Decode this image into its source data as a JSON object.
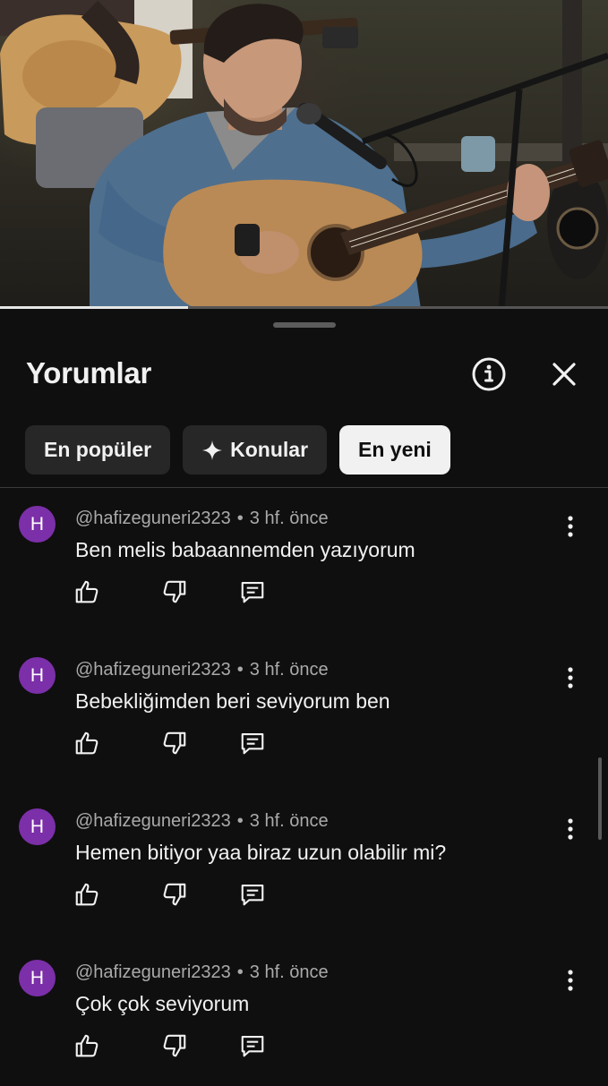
{
  "video": {
    "progress_fraction": 0.31
  },
  "panel": {
    "title": "Yorumlar",
    "info_icon": "info-circle-icon",
    "close_icon": "close-icon"
  },
  "chips": [
    {
      "label": "En popüler",
      "selected": false
    },
    {
      "label": "Konular",
      "icon": "sparkle-icon",
      "selected": false
    },
    {
      "label": "En yeni",
      "selected": true
    }
  ],
  "comments": [
    {
      "avatar_letter": "H",
      "author": "@hafizeguneri2323",
      "time": "3 hf. önce",
      "text": "Ben melis babaannemden yazıyorum"
    },
    {
      "avatar_letter": "H",
      "author": "@hafizeguneri2323",
      "time": "3 hf. önce",
      "text": "Bebekliğimden beri seviyorum ben"
    },
    {
      "avatar_letter": "H",
      "author": "@hafizeguneri2323",
      "time": "3 hf. önce",
      "text": "Hemen bitiyor yaa biraz uzun olabilir mi?"
    },
    {
      "avatar_letter": "H",
      "author": "@hafizeguneri2323",
      "time": "3 hf. önce",
      "text": "Çok çok seviyorum"
    }
  ],
  "colors": {
    "background": "#0f0f0f",
    "avatar": "#7b2fa8",
    "chip": "#272727",
    "chip_selected": "#f1f1f1",
    "meta_text": "#aaaaaa"
  }
}
